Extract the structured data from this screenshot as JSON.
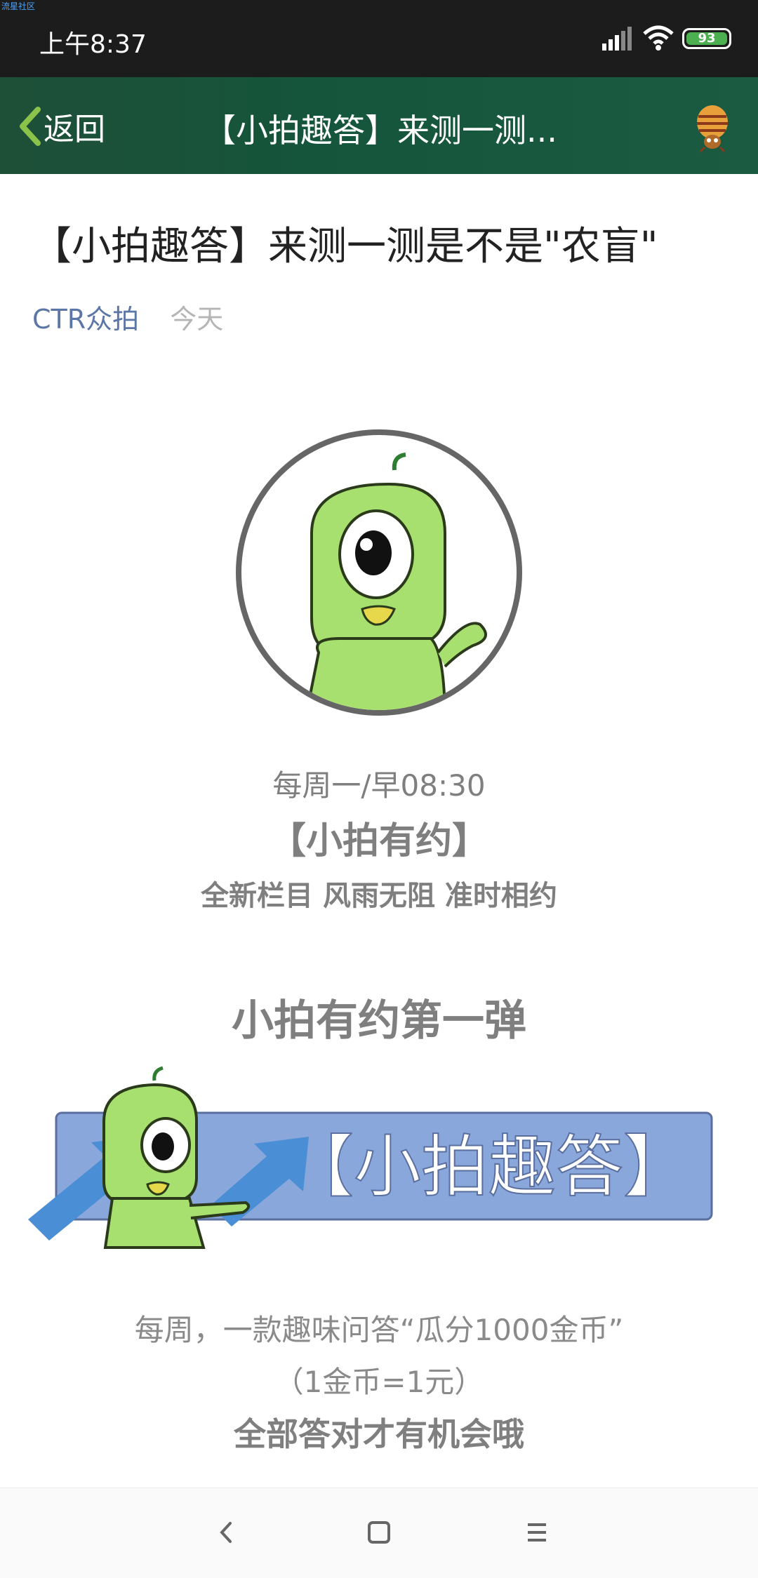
{
  "status_bar": {
    "watermark": "流星社区",
    "time": "上午8:37",
    "battery": "93"
  },
  "top_bar": {
    "back_label": "返回",
    "title": "【小拍趣答】来测一测..."
  },
  "article": {
    "title": "【小拍趣答】来测一测是不是\"农盲\"",
    "author": "CTR众拍",
    "date": "今天",
    "schedule": "每周一/早08:30",
    "column_name": "【小拍有约】",
    "slogan": "全新栏目 风雨无阻 准时相约",
    "section_heading": "小拍有约第一弹",
    "banner_text": "【小拍趣答】",
    "desc_line1": "每周，一款趣味问答“瓜分1000金币”",
    "desc_line2": "（1金币=1元）",
    "desc_line3": "全部答对才有机会哦"
  },
  "colors": {
    "status_bg": "#1c1c1c",
    "topbar_bg": "#1a5b41",
    "author_blue": "#5d76a8",
    "mascot_green": "#a8e070",
    "banner_blue": "#8aa7dc"
  },
  "nav_bar": {
    "icons": [
      "back-nav-icon",
      "home-nav-icon",
      "menu-nav-icon"
    ]
  }
}
